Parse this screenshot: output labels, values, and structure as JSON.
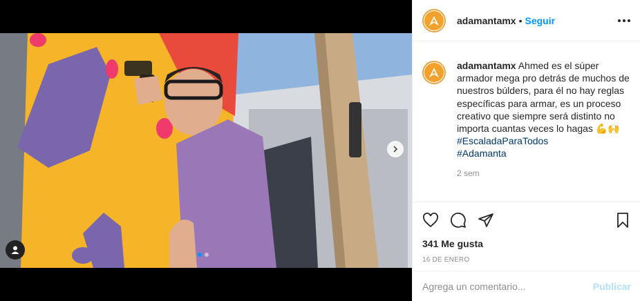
{
  "post": {
    "username": "adamantamx",
    "follow_label": "Seguir",
    "separator": "•"
  },
  "caption": {
    "username": "adamantamx",
    "text": "Ahmed es el súper armador mega pro detrás de muchos de nuestros búlders, para él no hay reglas específicas para armar, es un proceso creativo que siempre será distinto no importa cuantas veces lo hagas 💪🙌 ",
    "hashtag1": "#EscaladaParaTodos",
    "hashtag2": "#Adamanta",
    "time": "2 sem"
  },
  "next_comment": {
    "text": "..."
  },
  "actions": {
    "likes": "341 Me gusta",
    "date": "16 DE ENERO"
  },
  "comment": {
    "placeholder": "Agrega un comentario...",
    "publish_label": "Publicar"
  },
  "carousel": {
    "count": 2,
    "active": 1
  },
  "icons": [
    "heart-icon",
    "comment-icon",
    "share-icon",
    "bookmark-icon",
    "chevron-right-icon",
    "user-tag-icon",
    "more-icon"
  ],
  "colors": {
    "accent": "#0095f6",
    "brand": "#f2a22a",
    "hashtag": "#00376b",
    "wall": "#f6b429"
  }
}
